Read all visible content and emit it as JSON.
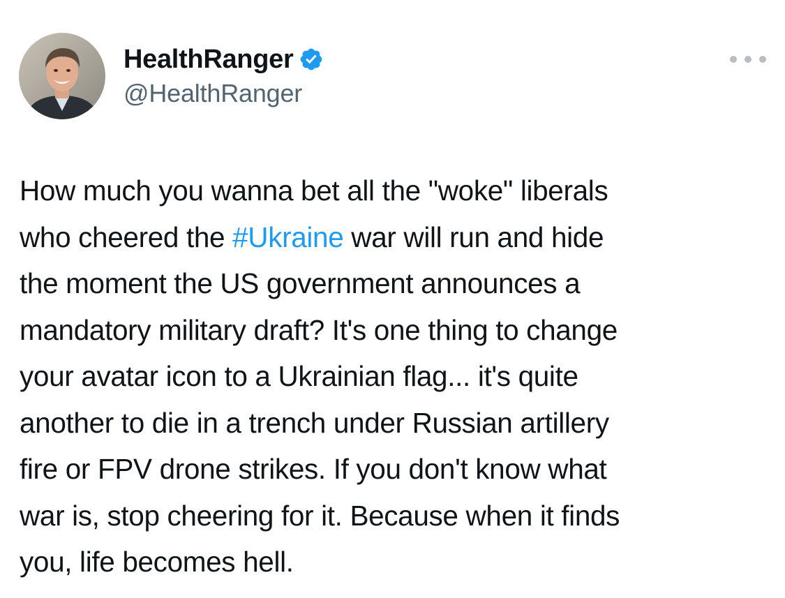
{
  "author": {
    "display_name": "HealthRanger",
    "handle": "@HealthRanger",
    "verified": true,
    "verified_color": "#1d9bf0",
    "avatar_icon": "profile-photo"
  },
  "menu": {
    "icon": "more-icon"
  },
  "tweet": {
    "lines": [
      {
        "text": "How much you wanna bet all the \"woke\" liberals"
      },
      {
        "before": "who cheered the ",
        "hashtag": "#Ukraine",
        "after": " war will run and hide"
      },
      {
        "text": "the moment the US government announces a"
      },
      {
        "text": "mandatory military draft? It's one thing to change"
      },
      {
        "text": "your avatar icon to a Ukrainian flag... it's quite"
      },
      {
        "text": "another to die in a trench under Russian artillery"
      },
      {
        "text": "fire or FPV drone strikes. If you don't know what"
      },
      {
        "text": "war is, stop cheering for it. Because when it finds"
      },
      {
        "text": "you, life becomes hell."
      }
    ],
    "hashtag_color": "#1d9bf0"
  }
}
